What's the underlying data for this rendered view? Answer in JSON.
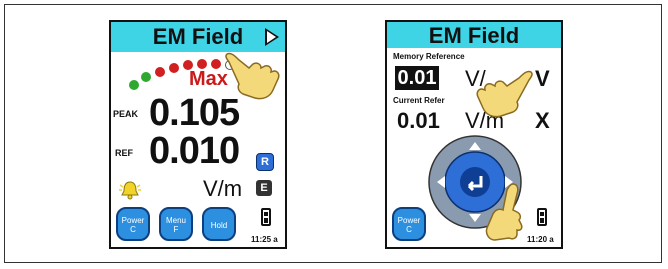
{
  "left_screen": {
    "title": "EM Field",
    "max_label": "Max",
    "peak_label": "PEAK",
    "peak_value": "0.105",
    "ref_label": "REF",
    "ref_value": "0.010",
    "unit": "V/m",
    "r_button": "R",
    "e_button": "E",
    "buttons": [
      {
        "line1": "Power",
        "line2": "C"
      },
      {
        "line1": "Menu",
        "line2": "F"
      },
      {
        "line1": "Hold",
        "line2": ""
      }
    ],
    "clock": "11:25 a",
    "dot_colors": [
      "#2ea82e",
      "#2ea82e",
      "#d02020",
      "#d02020",
      "#d02020",
      "#d02020",
      "#d02020",
      "#ffffff"
    ]
  },
  "right_screen": {
    "title": "EM Field",
    "memory_reference_label": "Memory Reference",
    "memory_reference_value": "0.01",
    "memory_reference_unit": "V/",
    "memory_reference_unit_letter": "V",
    "current_reference_label": "Current Refer",
    "current_reference_value": "0.01",
    "current_reference_unit": "V/m",
    "current_reference_letter": "X",
    "buttons": [
      {
        "line1": "Power",
        "line2": "C"
      }
    ],
    "clock": "11:20 a"
  },
  "colors": {
    "title_bar": "#3fd3e6",
    "button_blue": "#2d8fe0",
    "dpad_outer": "#8a9bb0",
    "dpad_inner": "#2d6fd6",
    "hand": "#f4d97a"
  }
}
